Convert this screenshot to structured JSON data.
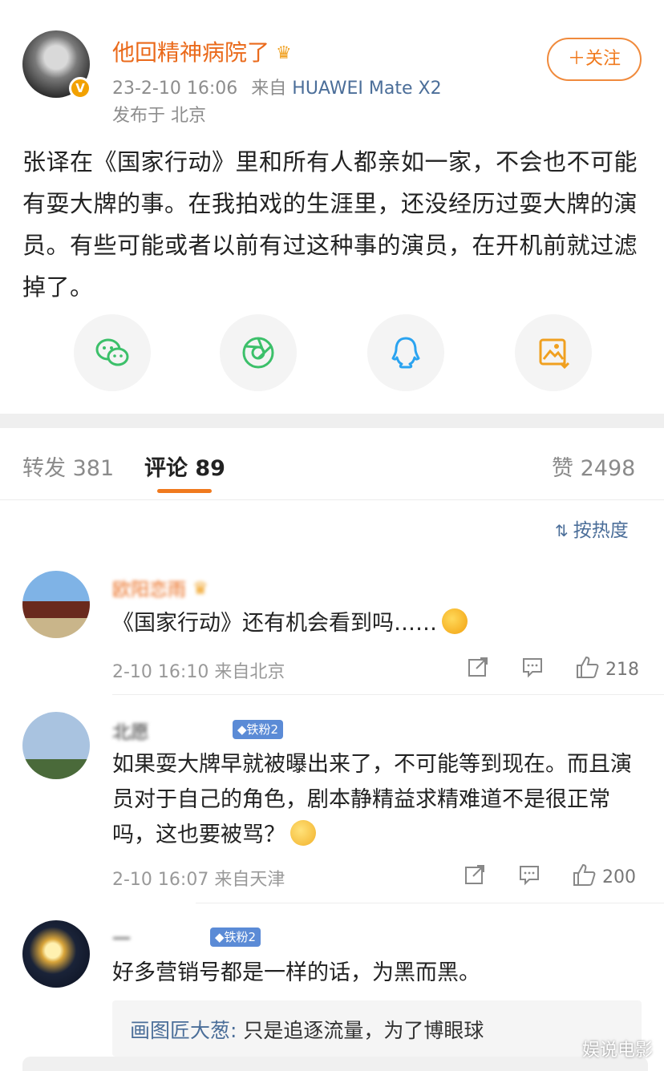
{
  "post": {
    "username": "他回精神病院了",
    "timestamp": "23-2-10 16:06",
    "source_prefix": "来自",
    "device": "HUAWEI Mate X2",
    "location": "发布于 北京",
    "follow_label": "＋关注",
    "verified_badge": "V",
    "text": "张译在《国家行动》里和所有人都亲如一家，不会也不可能有耍大牌的事。在我拍戏的生涯里，还没经历过耍大牌的演员。有些可能或者以前有过这种事的演员，在开机前就过滤掉了。"
  },
  "share_icons": [
    "wechat-icon",
    "moments-icon",
    "qq-icon",
    "save-image-icon"
  ],
  "tabs": {
    "repost": "转发 381",
    "comments": "评论 89",
    "likes": "赞 2498"
  },
  "sort": {
    "icon": "⇅",
    "label": "按热度"
  },
  "comments": [
    {
      "username": "欧阳恋雨",
      "text": "《国家行动》还有机会看到吗……",
      "meta": "2-10 16:10 来自北京",
      "likes": "218"
    },
    {
      "username": "北愿",
      "badge": "铁粉2",
      "text": "如果耍大牌早就被曝出来了，不可能等到现在。而且演员对于自己的角色，剧本静精益求精难道不是很正常吗，这也要被骂？",
      "meta": "2-10 16:07 来自天津",
      "likes": "200"
    },
    {
      "username": "一",
      "badge": "铁粉2",
      "text": "好多营销号都是一样的话，为黑而黑。",
      "reply_name": "画图匠大葱:",
      "reply_text": " 只是追逐流量，为了博眼球"
    }
  ],
  "watermark": "娱说电影",
  "colors": {
    "accent": "#f07a1e",
    "username": "#ea6a1b",
    "link": "#4b6e99"
  }
}
